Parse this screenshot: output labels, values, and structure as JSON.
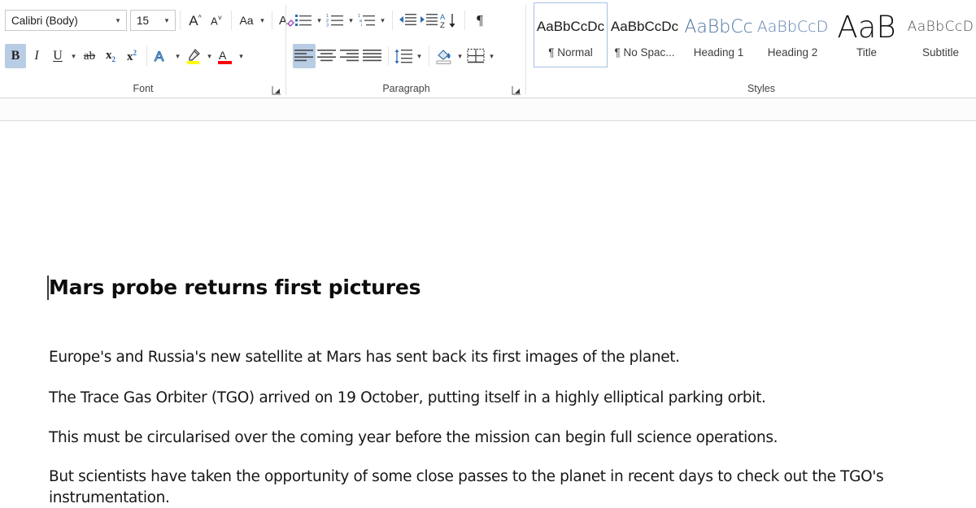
{
  "ribbon": {
    "groups": [
      {
        "name": "Font",
        "label": "Font"
      },
      {
        "name": "Paragraph",
        "label": "Paragraph"
      },
      {
        "name": "Styles",
        "label": "Styles"
      }
    ],
    "font_group": {
      "label": "Font",
      "font_name": {
        "value": "Calibri (Body)",
        "placeholder": "Font"
      },
      "font_size": {
        "value": "15",
        "placeholder": "Size"
      },
      "buttons": [
        {
          "name": "grow-font",
          "label": "A",
          "tooltip": "Increase Font Size"
        },
        {
          "name": "shrink-font",
          "label": "A",
          "tooltip": "Decrease Font Size"
        },
        {
          "name": "change-case",
          "label": "Aa",
          "tooltip": "Change Case"
        },
        {
          "name": "clear-formatting",
          "label": "A",
          "tooltip": "Clear All Formatting"
        },
        {
          "name": "bold",
          "label": "B",
          "tooltip": "Bold",
          "active": true
        },
        {
          "name": "italic",
          "label": "I",
          "tooltip": "Italic",
          "active": false
        },
        {
          "name": "underline",
          "label": "U",
          "tooltip": "Underline",
          "active": false
        },
        {
          "name": "strikethrough",
          "label": "ab",
          "tooltip": "Strikethrough",
          "active": false
        },
        {
          "name": "subscript",
          "label": "x",
          "sub": "2",
          "tooltip": "Subscript",
          "active": false
        },
        {
          "name": "superscript",
          "label": "x",
          "sup": "2",
          "tooltip": "Superscript",
          "active": false
        },
        {
          "name": "text-effects",
          "label": "A",
          "tooltip": "Text Effects and Typography"
        },
        {
          "name": "text-highlight-color",
          "label": "",
          "tooltip": "Text Highlight Color",
          "color": "#ffff00"
        },
        {
          "name": "font-color",
          "label": "A",
          "tooltip": "Font Color",
          "color": "#ff0000"
        }
      ]
    },
    "paragraph_group": {
      "label": "Paragraph",
      "buttons": [
        {
          "name": "bullets",
          "tooltip": "Bullets"
        },
        {
          "name": "numbering",
          "tooltip": "Numbering"
        },
        {
          "name": "multilevel-list",
          "tooltip": "Multilevel List"
        },
        {
          "name": "decrease-indent",
          "tooltip": "Decrease Indent"
        },
        {
          "name": "increase-indent",
          "tooltip": "Increase Indent"
        },
        {
          "name": "sort",
          "tooltip": "Sort"
        },
        {
          "name": "show-formatting-marks",
          "label": "¶",
          "tooltip": "Show/Hide Formatting Marks"
        },
        {
          "name": "align-left",
          "tooltip": "Align Left",
          "active": true
        },
        {
          "name": "align-center",
          "tooltip": "Center",
          "active": false
        },
        {
          "name": "align-right",
          "tooltip": "Align Right",
          "active": false
        },
        {
          "name": "justify",
          "tooltip": "Justify",
          "active": false
        },
        {
          "name": "line-spacing",
          "tooltip": "Line and Paragraph Spacing"
        },
        {
          "name": "shading",
          "tooltip": "Shading"
        },
        {
          "name": "borders",
          "tooltip": "Borders"
        }
      ]
    },
    "styles_group": {
      "label": "Styles",
      "items": [
        {
          "preview": "AaBbCcDc",
          "label": "¶ Normal",
          "selected": true
        },
        {
          "preview": "AaBbCcDc",
          "label": "¶ No Spac...",
          "selected": false
        },
        {
          "preview": "AaBbCc",
          "label": "Heading 1",
          "selected": false
        },
        {
          "preview": "AaBbCcD",
          "label": "Heading 2",
          "selected": false
        },
        {
          "preview": "AaB",
          "label": "Title",
          "selected": false
        },
        {
          "preview": "AaBbCcD",
          "label": "Subtitle",
          "selected": false
        }
      ]
    }
  },
  "document": {
    "title": "Mars probe returns first pictures",
    "paragraphs": [
      "Europe's and Russia's new satellite at Mars has sent back its first images of the planet.",
      "The Trace Gas Orbiter (TGO) arrived on 19 October, putting itself in a highly elliptical parking orbit.",
      "This must be circularised over the coming year before the mission can begin full science operations.",
      "But scientists have taken the opportunity of some close passes to the planet in recent days to check out the TGO's instrumentation."
    ]
  },
  "colors": {
    "accent_blue": "#2b6cb0",
    "active_button": "#b8cce4",
    "selected_style_border": "#a7c0e3",
    "highlight_yellow": "#ffff00",
    "font_color_red": "#ff0000",
    "ribbon_divider": "#d4d4d4"
  }
}
